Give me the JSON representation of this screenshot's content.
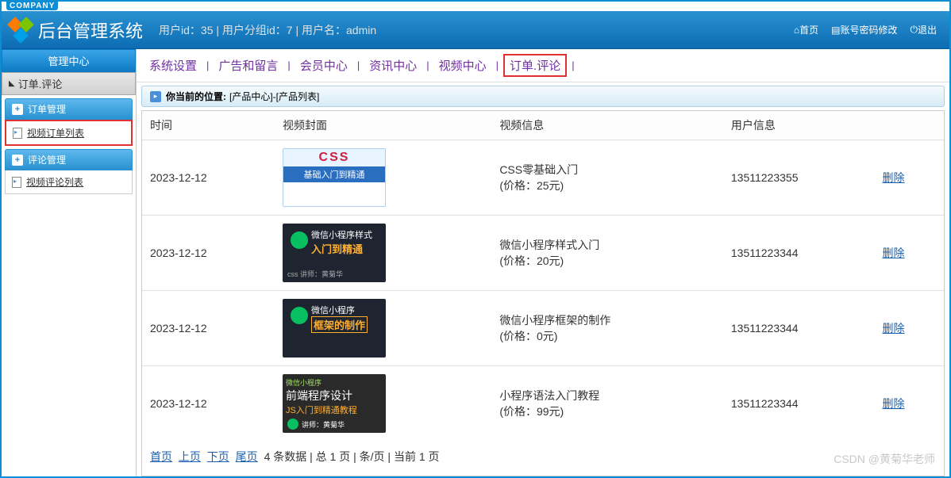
{
  "company_tag": "COMPANY",
  "header": {
    "title": "后台管理系统",
    "user_info": "用户id：35 | 用户分组id：7 | 用户名：admin",
    "home": "首页",
    "account": "账号密码修改",
    "logout": "退出"
  },
  "sidebar": {
    "center": "管理中心",
    "sub": "订单.评论",
    "panel1": "订单管理",
    "item1": "视频订单列表",
    "panel2": "评论管理",
    "item2": "视频评论列表"
  },
  "topnav": {
    "n1": "系统设置",
    "n2": "广告和留言",
    "n3": "会员中心",
    "n4": "资讯中心",
    "n5": "视频中心",
    "n6": "订单.评论"
  },
  "breadcrumb": {
    "label": "你当前的位置:",
    "path": "[产品中心]-[产品列表]"
  },
  "table": {
    "col_time": "时间",
    "col_cover": "视频封面",
    "col_video": "视频信息",
    "col_user": "用户信息",
    "col_action": "",
    "rows": [
      {
        "time": "2023-12-12",
        "title": "CSS零基础入门",
        "price": "(价格：25元)",
        "user": "13511223355",
        "action": "删除"
      },
      {
        "time": "2023-12-12",
        "title": "微信小程序样式入门",
        "price": "(价格：20元)",
        "user": "13511223344",
        "action": "删除"
      },
      {
        "time": "2023-12-12",
        "title": "微信小程序框架的制作",
        "price": "(价格：0元)",
        "user": "13511223344",
        "action": "删除"
      },
      {
        "time": "2023-12-12",
        "title": "小程序语法入门教程",
        "price": "(价格：99元)",
        "user": "13511223344",
        "action": "删除"
      }
    ]
  },
  "pagination": {
    "first": "首页",
    "prev": "上页",
    "next": "下页",
    "last": "尾页",
    "info": "4 条数据 | 总 1 页 |  条/页 | 当前 1 页"
  },
  "thumbs": {
    "t2_a": "微信小程序样式",
    "t2_b": "入门到精通",
    "t2_c": "css  讲师：黄菊华",
    "t3_a": "微信小程序",
    "t3_b": "框架的制作",
    "t4_0": "微信小程序",
    "t4_a": "前端程序设计",
    "t4_b": "JS入门到精通教程",
    "t4_c": "讲师：黄菊华"
  },
  "watermark": "CSDN @黄菊华老师"
}
